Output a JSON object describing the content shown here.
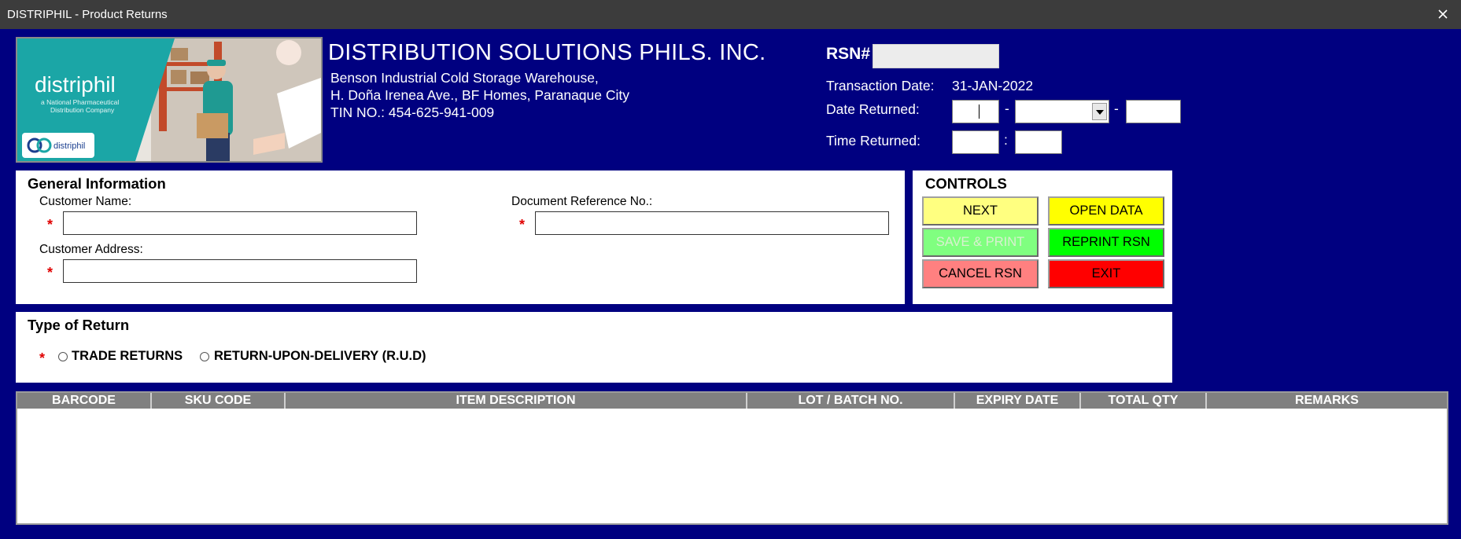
{
  "window": {
    "title": "DISTRIPHIL - Product Returns"
  },
  "logo": {
    "brand": "distriphil",
    "tagline1": "a National Pharmaceutical",
    "tagline2": "Distribution Company",
    "small_brand": "distriphil"
  },
  "company": {
    "name": "DISTRIBUTION SOLUTIONS PHILS. INC.",
    "address1": "Benson Industrial Cold Storage Warehouse,",
    "address2": "H. Doña Irenea Ave., BF Homes, Paranaque City",
    "tin": "TIN NO.: 454-625-941-009"
  },
  "header_fields": {
    "rsn_label": "RSN#",
    "rsn_value": "",
    "transaction_date_label": "Transaction Date:",
    "transaction_date_value": "31-JAN-2022",
    "date_returned_label": "Date Returned:",
    "date_sep1": "-",
    "date_sep2": "-",
    "time_returned_label": "Time Returned:",
    "time_sep": ":"
  },
  "general": {
    "heading": "General Information",
    "customer_name_label": "Customer Name:",
    "customer_address_label": "Customer Address:",
    "doc_ref_label": "Document Reference No.:",
    "required_mark": "*"
  },
  "controls": {
    "heading": "CONTROLS",
    "next": "NEXT",
    "open_data": "OPEN DATA",
    "save_print": "SAVE & PRINT",
    "reprint_rsn": "REPRINT RSN",
    "cancel_rsn": "CANCEL RSN",
    "exit": "EXIT"
  },
  "return_type": {
    "heading": "Type of Return",
    "required_mark": "*",
    "option1": "TRADE RETURNS",
    "option2": "RETURN-UPON-DELIVERY (R.U.D)"
  },
  "table": {
    "columns": [
      "BARCODE",
      "SKU CODE",
      "ITEM DESCRIPTION",
      "LOT / BATCH NO.",
      "EXPIRY DATE",
      "TOTAL QTY",
      "REMARKS"
    ],
    "rows": []
  },
  "colors": {
    "background": "#000080",
    "next": "#ffff80",
    "open_data": "#ffff00",
    "save_print": "#80ff80",
    "reprint_rsn": "#00ff00",
    "cancel_rsn": "#ff8080",
    "exit": "#ff0000"
  }
}
